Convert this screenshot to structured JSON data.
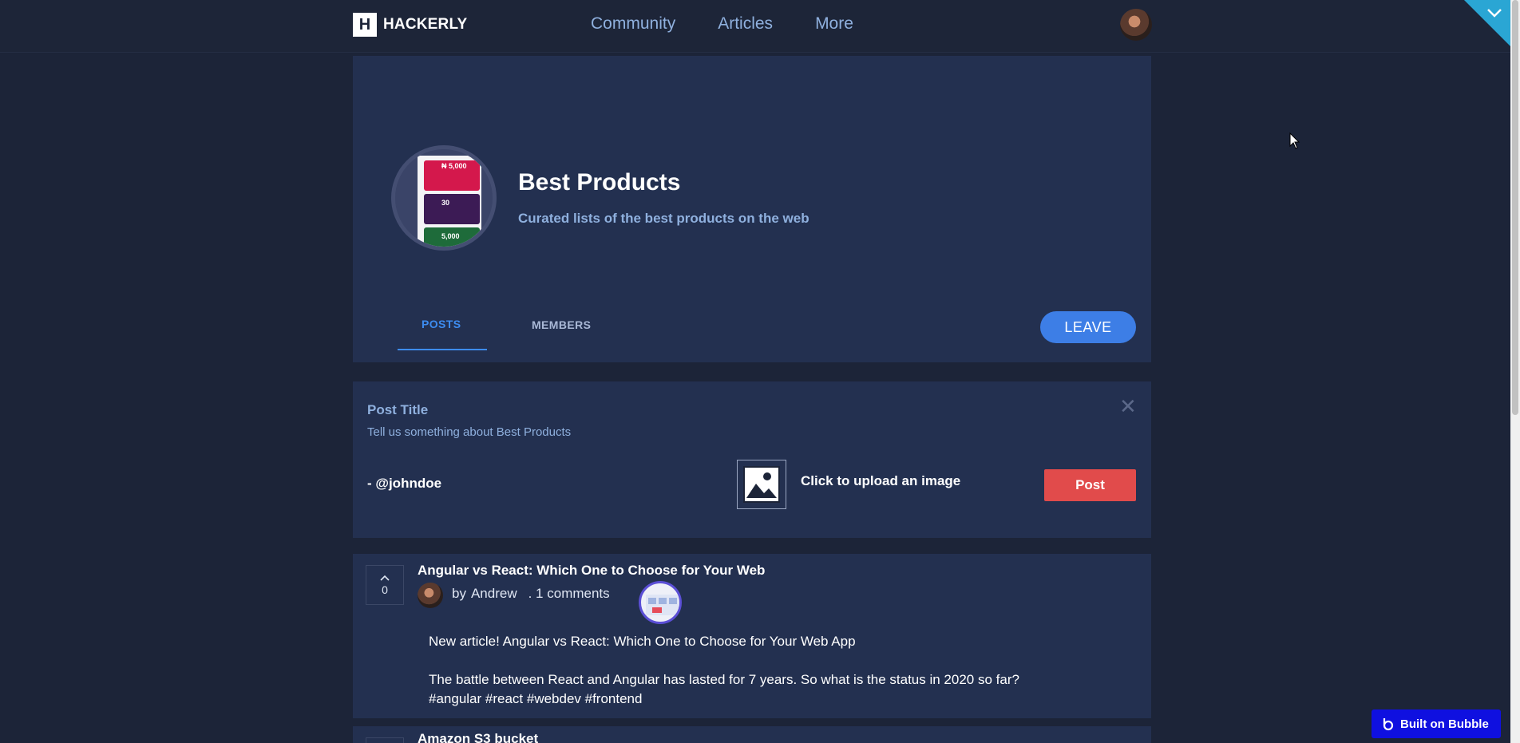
{
  "app": {
    "logo_letter": "H",
    "logo_name": "HACKERLY"
  },
  "nav": {
    "items": [
      "Community",
      "Articles",
      "More"
    ]
  },
  "community": {
    "title": "Best Products",
    "subtitle": "Curated lists of the best products on the web",
    "tabs": [
      "POSTS",
      "MEMBERS"
    ],
    "active_tab": "POSTS",
    "leave_label": "LEAVE",
    "image_texts": [
      "₦ 5,000",
      "30",
      "5,000"
    ]
  },
  "compose": {
    "title": "Post Title",
    "description": "Tell us something about Best Products",
    "close_glyph": "✕",
    "author": "- @johndoe",
    "upload_label": "Click to upload an image",
    "post_label": "Post"
  },
  "posts": [
    {
      "title": "Angular vs React: Which One to Choose for Your Web",
      "votes": "0",
      "by": "by",
      "author": "Andrew",
      "comments": ". 1 comments",
      "body_line1": "New article! Angular vs React: Which One to Choose for Your Web App",
      "body_line2": "The battle between React and Angular has lasted for 7 years. So what is the status in 2020 so far?",
      "body_line3": "#angular #react #webdev #frontend"
    },
    {
      "title": "Amazon S3 bucket"
    }
  ],
  "badge": {
    "label": "Built on Bubble"
  },
  "colors": {
    "background": "#1c2438",
    "card": "#233050",
    "accent_blue": "#3d8cf0",
    "post_button": "#e14b4b",
    "bubble_badge": "#0f10e0"
  },
  "icons": [
    "chevron-down-icon",
    "image-upload-icon",
    "upvote-icon",
    "close-icon",
    "bubble-logo-icon"
  ]
}
